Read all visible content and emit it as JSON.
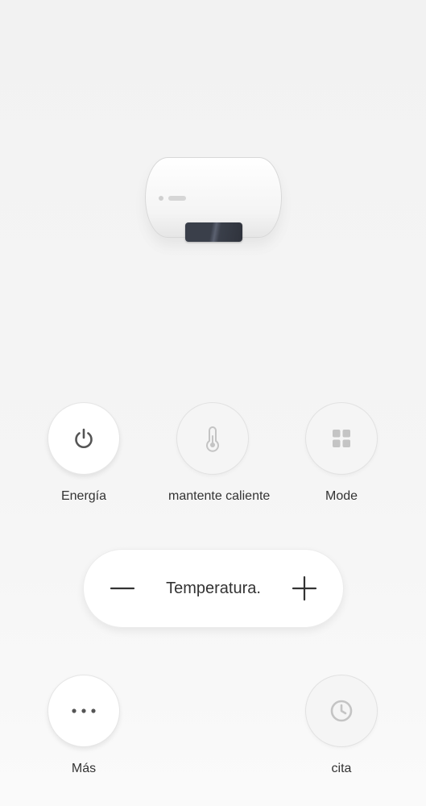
{
  "device": {
    "image_name": "water-heater-image"
  },
  "controls": {
    "power": {
      "label": "Energía",
      "icon": "power-icon",
      "state": "active"
    },
    "keep_warm": {
      "label": "mantente caliente",
      "icon": "thermometer-icon",
      "state": "inactive"
    },
    "mode": {
      "label": "Mode",
      "icon": "grid-icon",
      "state": "inactive"
    }
  },
  "temperature": {
    "label": "Temperatura.",
    "decrease_icon": "minus-icon",
    "increase_icon": "plus-icon"
  },
  "bottom": {
    "more": {
      "label": "Más",
      "icon": "more-dots-icon",
      "state": "active"
    },
    "schedule": {
      "label": "cita",
      "icon": "clock-icon",
      "state": "inactive"
    }
  },
  "colors": {
    "background": "#f2f2f2",
    "button_active_icon": "#555555",
    "button_inactive_icon": "#c4c4c4",
    "text": "#333333"
  }
}
